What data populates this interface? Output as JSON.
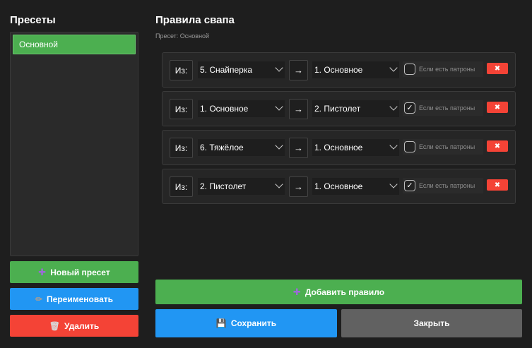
{
  "presets": {
    "title": "Пресеты",
    "items": [
      {
        "label": "Основной",
        "selected": true
      }
    ],
    "new_label": "Новый пресет",
    "rename_label": "Переименовать",
    "delete_label": "Удалить"
  },
  "rules_panel": {
    "title": "Правила свапа",
    "subtitle": "Пресет: Основной",
    "from_label": "Из:",
    "arrow": "→",
    "ammo_label": "Если есть патроны",
    "delete_glyph": "✖",
    "rules": [
      {
        "from": "5. Снайперка",
        "to": "1. Основное",
        "if_ammo": false
      },
      {
        "from": "1. Основное",
        "to": "2. Пистолет",
        "if_ammo": true
      },
      {
        "from": "6. Тяжёлое",
        "to": "1. Основное",
        "if_ammo": false
      },
      {
        "from": "2. Пистолет",
        "to": "1. Основное",
        "if_ammo": true
      }
    ],
    "add_rule_label": "Добавить правило",
    "save_label": "Сохранить",
    "close_label": "Закрыть"
  },
  "colors": {
    "green": "#4caf50",
    "blue": "#2196f3",
    "red": "#f44336",
    "gray": "#616161",
    "background": "#1e1e1e"
  },
  "icons": {
    "plus": "plus-icon",
    "pencil": "pencil-icon",
    "trash": "trash-icon",
    "floppy": "floppy-icon",
    "check": "checkmark-icon",
    "delete": "cross-icon"
  }
}
